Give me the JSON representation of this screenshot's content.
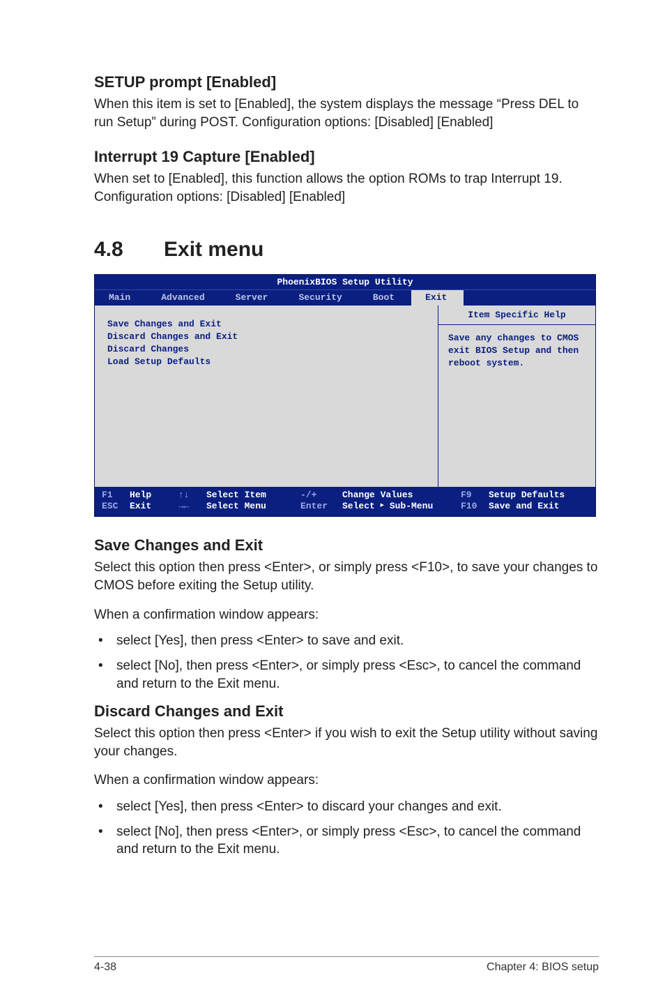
{
  "s1": {
    "h": "SETUP prompt [Enabled]",
    "p": "When this item is set to [Enabled], the system displays the message “Press DEL to run Setup” during POST. Configuration options: [Disabled] [Enabled]"
  },
  "s2": {
    "h": "Interrupt 19 Capture [Enabled]",
    "p": "When set to [Enabled], this function allows the option ROMs to trap Interrupt 19. Configuration options: [Disabled] [Enabled]"
  },
  "sec": {
    "num": "4.8",
    "title": "Exit menu"
  },
  "bios": {
    "title": "PhoenixBIOS Setup Utility",
    "tabs": [
      "Main",
      "Advanced",
      "Server",
      "Security",
      "Boot",
      "Exit"
    ],
    "left": [
      "Save Changes and Exit",
      "Discard Changes and Exit",
      "Discard Changes",
      "Load Setup Defaults"
    ],
    "right_title": "Item Specific Help",
    "right_body": "Save any changes to CMOS exit BIOS Setup and then reboot system.",
    "foot": {
      "r1": {
        "k1": "F1",
        "k2": "Help",
        "k3": "↑↓",
        "k4": "Select Item",
        "k5": "-/+",
        "k6": "Change Values",
        "k7": "F9",
        "k8": "Setup Defaults"
      },
      "r2": {
        "k1": "ESC",
        "k2": "Exit",
        "k3": "→←",
        "k4": "Select Menu",
        "k5": "Enter",
        "k6a": "Select ",
        "k6b": " Sub-Menu",
        "k7": "F10",
        "k8": "Save and Exit"
      }
    }
  },
  "s3": {
    "h": "Save Changes and Exit",
    "p1": "Select this option then press <Enter>, or simply press <F10>, to save your changes to CMOS before exiting the Setup utility.",
    "p2": "When a confirmation window appears:",
    "li1": "select [Yes], then press <Enter> to save and exit.",
    "li2": "select [No], then press <Enter>, or simply press <Esc>, to cancel the command and return to the Exit menu."
  },
  "s4": {
    "h": "Discard Changes and Exit",
    "p1": "Select this option then press <Enter> if you wish to exit the Setup utility without saving your changes.",
    "p2": "When a confirmation window appears:",
    "li1": "select [Yes], then press <Enter> to discard your changes and exit.",
    "li2": "select [No], then press <Enter>, or simply press <Esc>, to cancel the command and return to the Exit menu."
  },
  "footer": {
    "left": "4-38",
    "right": "Chapter 4: BIOS setup"
  }
}
